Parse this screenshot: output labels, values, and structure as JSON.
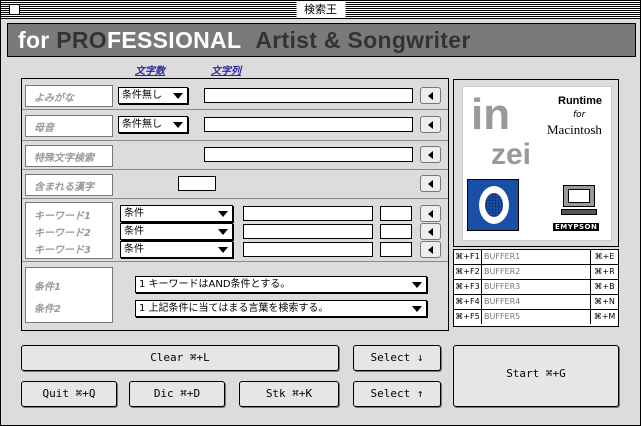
{
  "window": {
    "title": "検索王"
  },
  "banner": {
    "part1": "for ",
    "part2": "PRO",
    "part3": "FESSIONAL",
    "part4": "Artist & Songwriter"
  },
  "columns": {
    "char_count": "文字数",
    "char_order": "文字列"
  },
  "rows": {
    "yomi": {
      "label": "よみがな",
      "select": "条件無し"
    },
    "onin": {
      "label": "母音",
      "select": "条件無し"
    },
    "special": {
      "label": "特殊文字検索"
    },
    "include": {
      "label": "含まれる漢字"
    },
    "keywords": {
      "labels": [
        "キーワード1",
        "キーワード2",
        "キーワード3"
      ],
      "selects": [
        "条件",
        "条件",
        "条件"
      ]
    },
    "conditions": {
      "labels": [
        "条件1",
        "条件2"
      ],
      "selects": [
        "1 キーワードはAND条件とする。",
        "1 上記条件に当てはまる言葉を検索する。"
      ]
    }
  },
  "logo": {
    "line1": "in",
    "line2": "zei",
    "runtime": "Runtime",
    "for": "for",
    "mac": "Macintosh",
    "brand": "EMYPSON"
  },
  "buffers": [
    {
      "key": "⌘+F1",
      "name": "BUFFER1",
      "shortcut": "⌘+E"
    },
    {
      "key": "⌘+F2",
      "name": "BUFFER2",
      "shortcut": "⌘+R"
    },
    {
      "key": "⌘+F3",
      "name": "BUFFER3",
      "shortcut": "⌘+B"
    },
    {
      "key": "⌘+F4",
      "name": "BUFFER4",
      "shortcut": "⌘+N"
    },
    {
      "key": "⌘+F5",
      "name": "BUFFER5",
      "shortcut": "⌘+M"
    }
  ],
  "buttons": {
    "clear": "Clear ⌘+L",
    "select_down": "Select ↓",
    "select_up": "Select ↑",
    "start": "Start ⌘+G",
    "quit": "Quit ⌘+Q",
    "dic": "Dic ⌘+D",
    "stk": "Stk ⌘+K"
  },
  "colors": {
    "banner_bg": "#7a7a7a",
    "accent_blue": "#1a4fa8",
    "panel_bg": "#dcdcdc"
  }
}
